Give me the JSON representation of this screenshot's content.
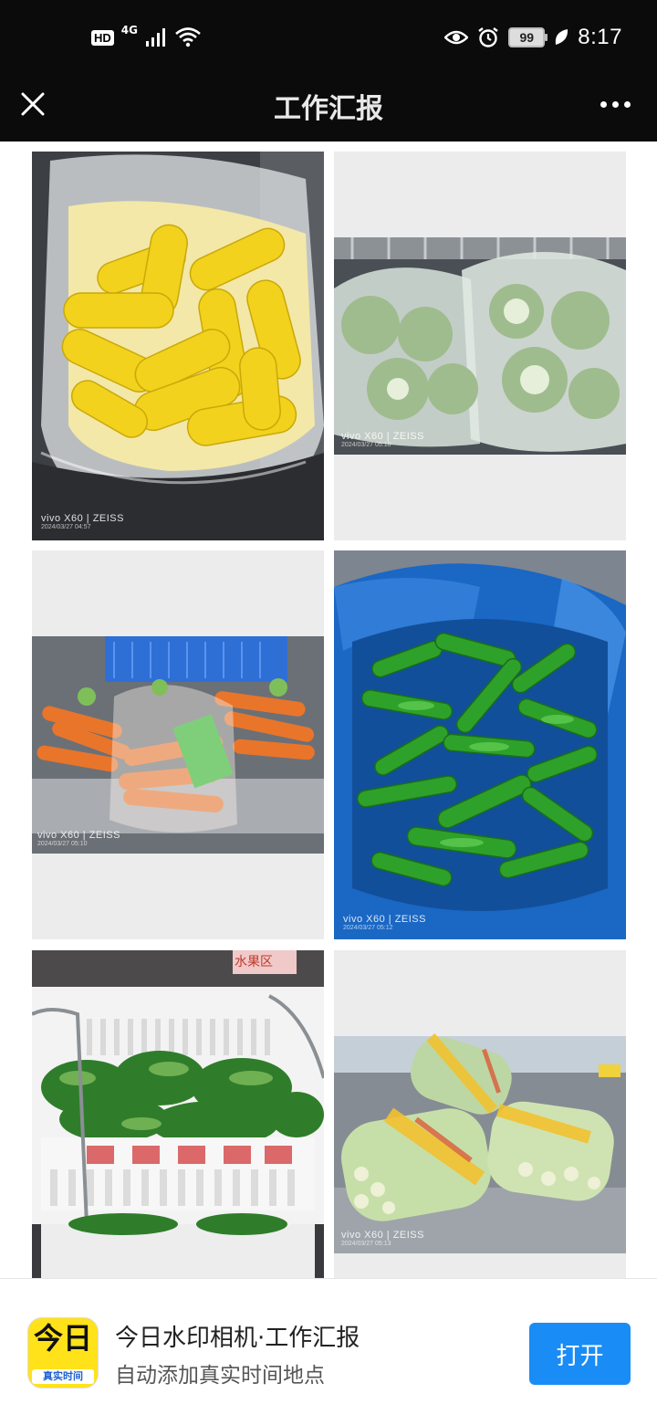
{
  "status_bar": {
    "hd_badge": "HD",
    "network": "4G",
    "battery_level": "99",
    "time": "8:17",
    "icons": [
      "signal-icon",
      "wifi-icon",
      "eye-icon",
      "alarm-icon",
      "battery-icon",
      "leaf-icon"
    ]
  },
  "header": {
    "title": "工作汇报",
    "close_icon": "close-icon",
    "more_icon": "more-icon"
  },
  "photos": [
    {
      "subject": "corn",
      "brand": "vivo",
      "model": "X60",
      "lens": "ZEISS",
      "timestamp": "2024/03/27 04:57"
    },
    {
      "subject": "cabbage",
      "brand": "vivo",
      "model": "X60",
      "lens": "ZEISS",
      "timestamp": "2024/03/27 05:10"
    },
    {
      "subject": "carrots",
      "brand": "vivo",
      "model": "X60",
      "lens": "ZEISS",
      "timestamp": "2024/03/27 05:10"
    },
    {
      "subject": "green-peppers",
      "brand": "vivo",
      "model": "X60",
      "lens": "ZEISS",
      "timestamp": "2024/03/27 05:12"
    },
    {
      "subject": "leafy-greens",
      "sign_text": "水果区"
    },
    {
      "subject": "lettuce-bundles",
      "brand": "vivo",
      "model": "X60",
      "lens": "ZEISS",
      "timestamp": "2024/03/27 05:13"
    }
  ],
  "banner": {
    "app_icon_text": "今日",
    "app_icon_subtext": "真实时间",
    "title": "今日水印相机·工作汇报",
    "subtitle": "自动添加真实时间地点",
    "open_button": "打开",
    "accent_color": "#1a8cf5"
  }
}
